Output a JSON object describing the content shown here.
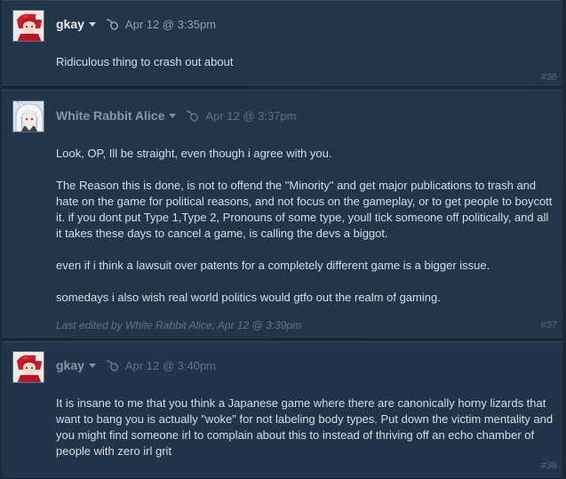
{
  "colors": {
    "background": "#1b2838",
    "post_background": "#233549",
    "author_name": "#e6eef5",
    "author_name_dim": "#8797a9",
    "timestamp": "#8ba1b7",
    "body_text": "#d5dee7",
    "post_number": "#56677a"
  },
  "posts": [
    {
      "author": "gkay",
      "avatar_icon": "anime-avatar-red-icon",
      "platform_icon": "mouse-icon",
      "timestamp": "Apr 12 @ 3:35pm",
      "body": [
        "Ridiculous thing to crash out about"
      ],
      "number": "#36"
    },
    {
      "author": "White Rabbit Alice",
      "avatar_icon": "anime-avatar-white-hair-icon",
      "platform_icon": "mouse-icon",
      "timestamp": "Apr 12 @ 3:37pm",
      "body": [
        "Look, OP, Ill be straight, even though i agree with you.",
        "The Reason this is done, is not to offend the \"Minority\" and get major publications to trash and hate on the game for political reasons, and not focus on the gameplay, or to get people to boycott it. if you dont put Type 1,Type 2, Pronouns of some type, youll tick someone off politically, and all it takes these days to cancel a game, is calling the devs a biggot.",
        "even if i think a lawsuit over patents for a completely different game is a bigger issue.",
        "somedays i also wish real world politics would gtfo out the realm of gaming."
      ],
      "edited": "Last edited by White Rabbit Alice; Apr 12 @ 3:39pm",
      "number": "#37"
    },
    {
      "author": "gkay",
      "avatar_icon": "anime-avatar-red-icon",
      "platform_icon": "mouse-icon",
      "timestamp": "Apr 12 @ 3:40pm",
      "body": [
        "It is insane to me that you think a Japanese game where there are canonically horny lizards that want to bang you is actually \"woke\" for not labeling body types. Put down the victim mentality and you might find someone irl to complain about this to instead of thriving off an echo chamber of people with zero irl grit"
      ],
      "number": "#38"
    }
  ]
}
